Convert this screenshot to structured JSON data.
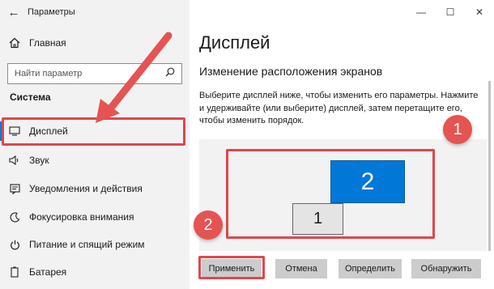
{
  "window": {
    "title": "Параметры",
    "back_glyph": "←",
    "minimize_glyph": "—",
    "maximize_glyph": "☐",
    "close_glyph": "✕"
  },
  "sidebar": {
    "home_label": "Главная",
    "search_placeholder": "Найти параметр",
    "section_header": "Система",
    "items": [
      {
        "label": "Дисплей",
        "icon": "monitor-icon",
        "selected": true
      },
      {
        "label": "Звук",
        "icon": "speaker-icon"
      },
      {
        "label": "Уведомления и действия",
        "icon": "notification-icon"
      },
      {
        "label": "Фокусировка внимания",
        "icon": "moon-icon"
      },
      {
        "label": "Питание и спящий режим",
        "icon": "power-icon"
      },
      {
        "label": "Батарея",
        "icon": "battery-icon"
      }
    ]
  },
  "main": {
    "page_title": "Дисплей",
    "subtitle": "Изменение расположения экранов",
    "description_lines": [
      "Выберите дисплей ниже, чтобы изменить его параметры. Нажмите",
      "и удерживайте (или выберите) дисплей, затем перетащите его,",
      "чтобы изменить порядок."
    ],
    "monitors": [
      {
        "number": "1",
        "selected": false
      },
      {
        "number": "2",
        "selected": true
      }
    ],
    "buttons": {
      "apply": "Применить",
      "cancel": "Отмена",
      "identify": "Определить",
      "detect": "Обнаружить"
    }
  },
  "annotations": {
    "badge_1": "1",
    "badge_2": "2",
    "highlight_color": "#e0474c",
    "badge_color": "#e55353"
  },
  "colors": {
    "accent": "#0078d7",
    "sidebar_bg": "#f2f2f2",
    "button_bg": "#cccccc"
  }
}
